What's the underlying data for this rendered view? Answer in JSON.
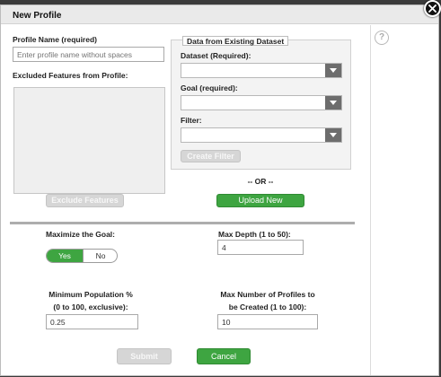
{
  "dialog": {
    "title": "New Profile"
  },
  "help": {
    "glyph": "?"
  },
  "profile_name": {
    "label": "Profile Name (required)",
    "placeholder": "Enter profile name without spaces",
    "value": ""
  },
  "excluded": {
    "label": "Excluded Features from Profile:",
    "items": []
  },
  "existing_dataset": {
    "legend": "Data from Existing Dataset",
    "dataset_label": "Dataset (Required):",
    "goal_label": "Goal (required):",
    "filter_label": "Filter:",
    "create_filter_label": "Create Filter"
  },
  "or_text": "-- OR --",
  "upload_new_label": "Upload New",
  "exclude_features_label": "Exclude Features",
  "maximize": {
    "label": "Maximize the Goal:",
    "yes": "Yes",
    "no": "No",
    "selected": "Yes"
  },
  "max_depth": {
    "label": "Max Depth (1 to 50):",
    "value": "4"
  },
  "min_population": {
    "label_line1": "Minimum Population %",
    "label_line2": "(0 to 100, exclusive):",
    "value": "0.25"
  },
  "max_profiles": {
    "label_line1": "Max Number of Profiles to",
    "label_line2": "be Created (1 to 100):",
    "value": "10"
  },
  "actions": {
    "submit": "Submit",
    "cancel": "Cancel"
  },
  "colors": {
    "accent_green": "#3ea541",
    "disabled_gray": "#d6d6d6"
  }
}
